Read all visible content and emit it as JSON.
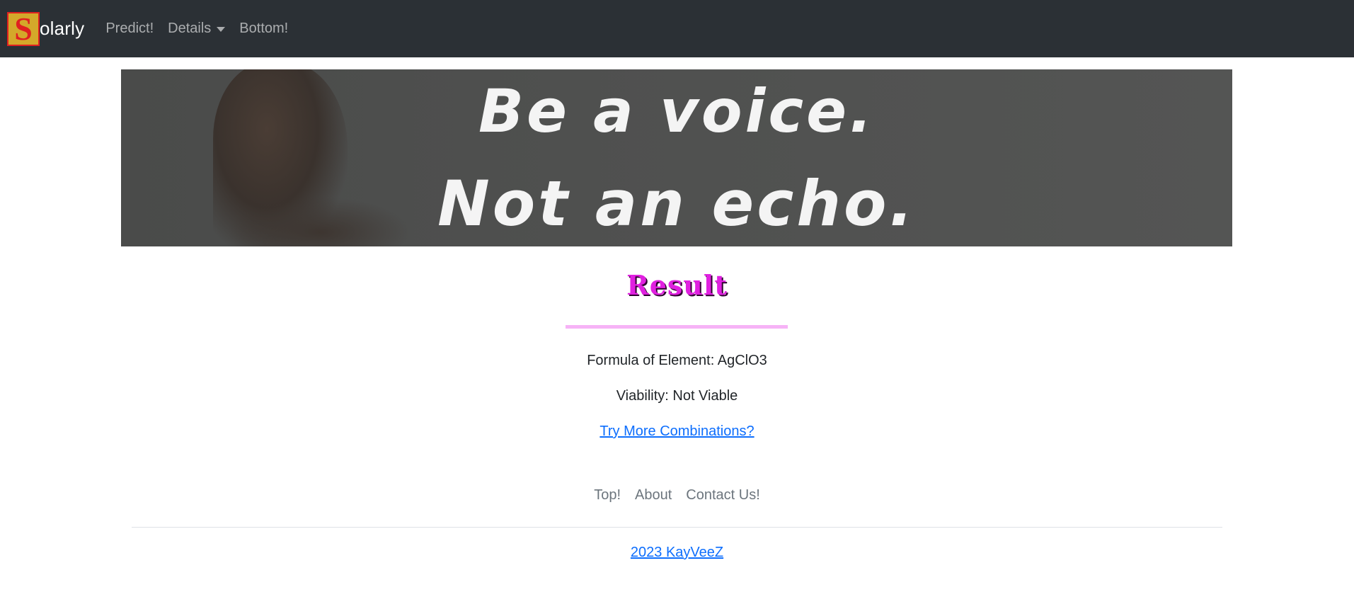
{
  "navbar": {
    "logo_letter": "S",
    "brand_suffix": "olarly",
    "links": [
      {
        "label": "Predict!"
      },
      {
        "label": "Details"
      },
      {
        "label": "Bottom!"
      }
    ]
  },
  "banner": {
    "line1": "Be a voice.",
    "line2": "Not an echo."
  },
  "result": {
    "title": "Result",
    "formula_text": "Formula of Element: AgClO3",
    "viability_text": "Viability: Not Viable",
    "try_more_label": "Try More Combinations?"
  },
  "footer": {
    "links": [
      {
        "label": "Top!"
      },
      {
        "label": "About"
      },
      {
        "label": "Contact Us!"
      }
    ],
    "copyright": "2023 KayVeeZ"
  },
  "colors": {
    "navbar_bg": "#2b3035",
    "result_title": "#e020e0",
    "divider": "#f6b3f6",
    "link": "#0d6efd"
  }
}
